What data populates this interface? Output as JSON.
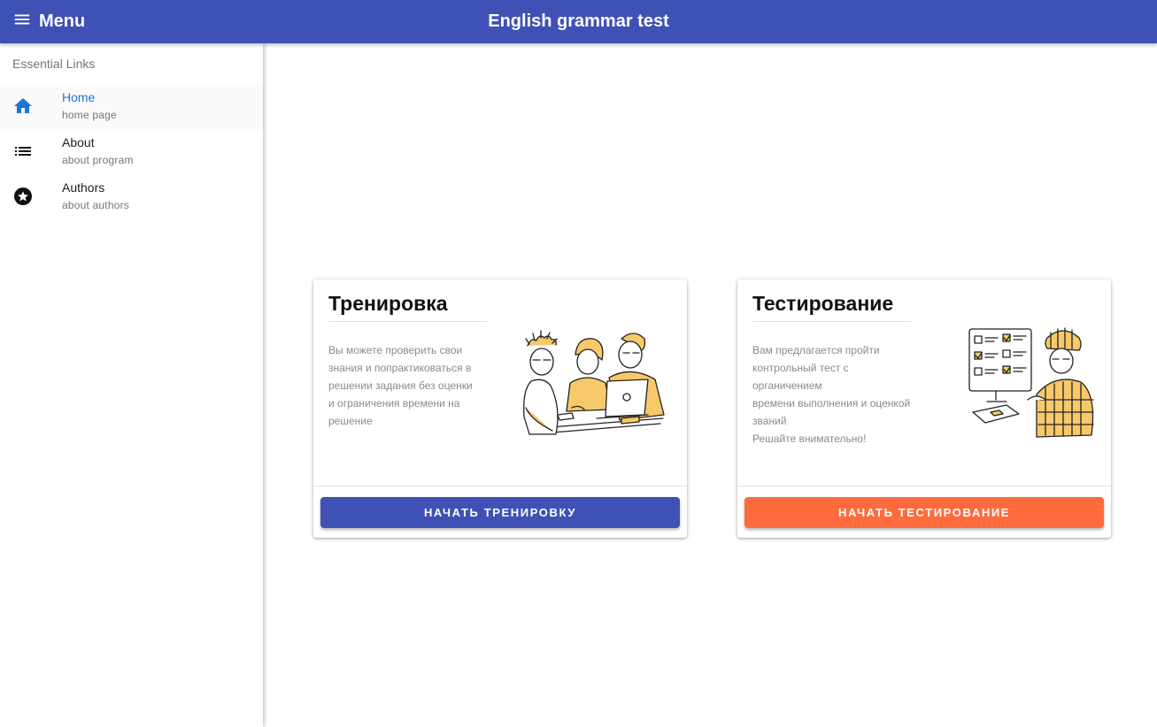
{
  "header": {
    "menu_label": "Menu",
    "title": "English grammar test",
    "menu_icon": "hamburger-menu-icon",
    "background_color": "#3f51b5"
  },
  "drawer": {
    "header": "Essential Links",
    "items": [
      {
        "title": "Home",
        "caption": "home page",
        "icon": "home-icon",
        "active": true
      },
      {
        "title": "About",
        "caption": "about program",
        "icon": "list-icon",
        "active": false
      },
      {
        "title": "Authors",
        "caption": "about authors",
        "icon": "star-circle-icon",
        "active": false
      }
    ]
  },
  "cards": [
    {
      "title": "Тренировка",
      "text_lines": [
        "Вы можете проверить свои",
        "знания и попрактиковаться в",
        "решении задания без оценки",
        "и ограничения времени на",
        "решение"
      ],
      "illustration": "people-at-laptop-illustration",
      "button_label": "НАЧАТЬ ТРЕНИРОВКУ",
      "button_color": "#3f51b5"
    },
    {
      "title": "Тестирование",
      "text_lines": [
        "Вам предлагается пройти",
        "контрольный тест с органичением",
        "времени выполнения и оценкой",
        "званий",
        "Решайте внимательно!"
      ],
      "illustration": "person-taking-test-illustration",
      "button_label": "НАЧАТЬ ТЕСТИРОВАНИЕ",
      "button_color": "#ff6b3d"
    }
  ],
  "colors": {
    "accent_active": "#1976d2",
    "illustration_yellow": "#f7c96a"
  }
}
